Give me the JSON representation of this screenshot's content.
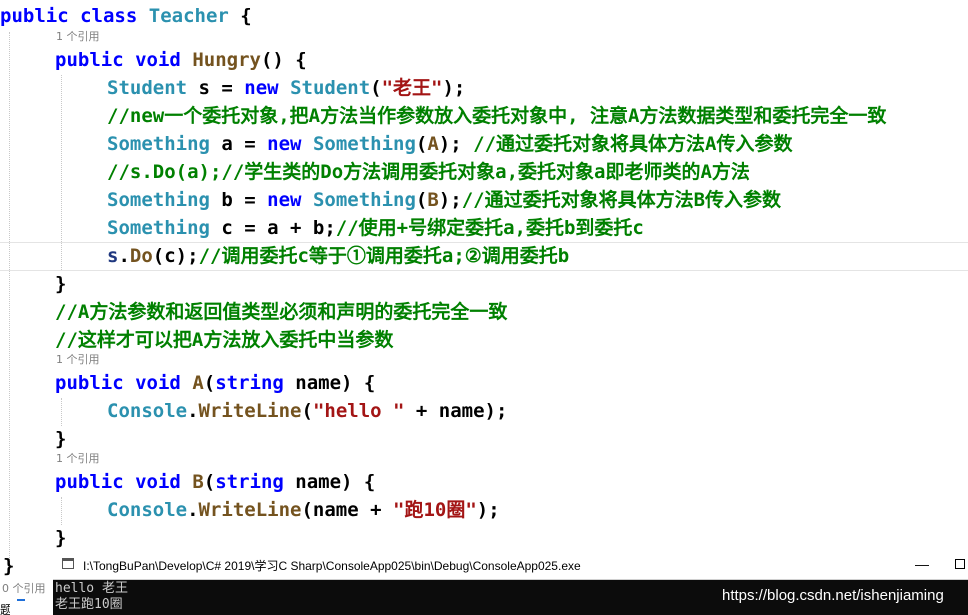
{
  "editor": {
    "ref_label": "1 个引用",
    "class_decl": {
      "kw1": "public",
      "kw2": "class",
      "name": "Teacher",
      "brace": "{"
    },
    "hungry_decl": {
      "kw1": "public",
      "kw2": "void",
      "name": "Hungry",
      "rest": "() {"
    },
    "line_student": {
      "type1": "Student",
      "var": " s = ",
      "kw": "new",
      "type2": "Student",
      "open": "(",
      "str": "\"老王\"",
      "close": ");"
    },
    "comment1": "//new一个委托对象,把A方法当作参数放入委托对象中, 注意A方法数据类型和委托完全一致",
    "line_a": {
      "type1": "Something",
      "var": " a = ",
      "kw": "new",
      "type2": "Something",
      "open": "(",
      "arg": "A",
      "close": "); ",
      "comment": "//通过委托对象将具体方法A传入参数"
    },
    "comment2": "//s.Do(a);//学生类的Do方法调用委托对象a,委托对象a即老师类的A方法",
    "line_b": {
      "type1": "Something",
      "var": " b = ",
      "kw": "new",
      "type2": "Something",
      "open": "(",
      "arg": "B",
      "close": ");",
      "comment": "//通过委托对象将具体方法B传入参数"
    },
    "line_c": {
      "type1": "Something",
      "rest": " c = a + b;",
      "comment": "//使用+号绑定委托a,委托b到委托c"
    },
    "line_do": {
      "obj": "s",
      "dot": ".",
      "fn": "Do",
      "rest": "(c);",
      "comment": "//调用委托c等于①调用委托a;②调用委托b"
    },
    "close_brace": "}",
    "comment3": "//A方法参数和返回值类型必须和声明的委托完全一致",
    "comment4": "//这样才可以把A方法放入委托中当参数",
    "a_decl": {
      "kw1": "public",
      "kw2": "void",
      "name": "A",
      "open": "(",
      "kw3": "string",
      "param": " name) {"
    },
    "a_body": {
      "type": "Console",
      "dot": ".",
      "fn": "WriteLine",
      "open": "(",
      "str": "\"hello \"",
      "rest": " + name);"
    },
    "b_decl": {
      "kw1": "public",
      "kw2": "void",
      "name": "B",
      "open": "(",
      "kw3": "string",
      "param": " name) {"
    },
    "b_body": {
      "type": "Console",
      "dot": ".",
      "fn": "WriteLine",
      "open": "(name + ",
      "str": "\"跑10圈\"",
      "rest": ");"
    },
    "bottom_ref": "0 个引用",
    "left_cut": "题"
  },
  "console": {
    "title": "I:\\TongBuPan\\Develop\\C# 2019\\学习C Sharp\\ConsoleApp025\\bin\\Debug\\ConsoleApp025.exe",
    "output": [
      "hello 老王",
      "老王跑10圈"
    ],
    "minimize_glyph": "—"
  },
  "watermark": "https://blog.csdn.net/ishenjiaming",
  "colors": {
    "keyword": "#0000ff",
    "type": "#2b91af",
    "string": "#a31515",
    "comment": "#008000",
    "method": "#74531f"
  }
}
